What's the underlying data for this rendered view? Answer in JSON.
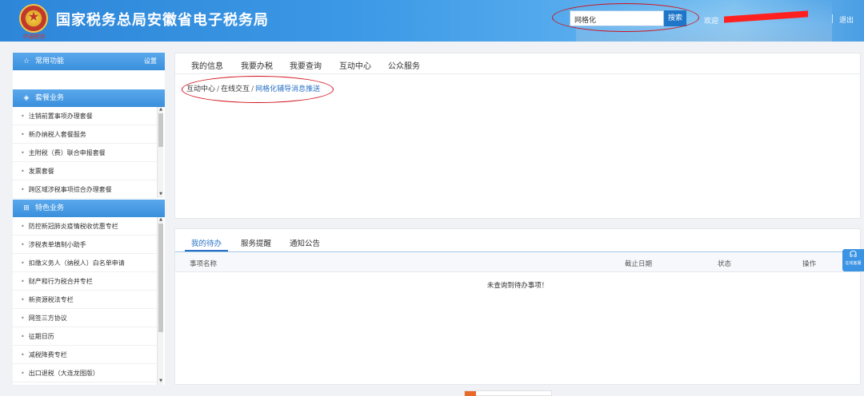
{
  "header": {
    "title": "国家税务总局安徽省电子税务局",
    "emblem_caption": "中国税务",
    "search_value": "网格化",
    "search_button": "搜索",
    "welcome_prefix": "欢迎",
    "logout": "退出"
  },
  "sidebar": {
    "common": {
      "title": "常用功能",
      "settings": "设置",
      "icon": "star-outline-icon"
    },
    "package": {
      "title": "套餐业务",
      "icon": "layers-icon",
      "items": [
        "注销前置事项办理套餐",
        "新办纳税人套餐服务",
        "主附税（费）联合申报套餐",
        "发票套餐",
        "跨区域涉税事项综合办理套餐"
      ]
    },
    "feature": {
      "title": "特色业务",
      "icon": "grid-icon",
      "items": [
        "防控新冠肺炎疫情税收优惠专栏",
        "涉税表单填制小助手",
        "扣缴义务人（纳税人）白名单申请",
        "财产和行为税合并专栏",
        "新资源税法专栏",
        "网签三方协议",
        "征期日历",
        "减税降费专栏",
        "出口退税（大连龙图版）"
      ]
    }
  },
  "nav": {
    "items": [
      "我的信息",
      "我要办税",
      "我要查询",
      "互动中心",
      "公众服务"
    ]
  },
  "breadcrumb": {
    "items": [
      "互动中心",
      "在线交互",
      "网格化辅导消息推送"
    ],
    "separator": "/"
  },
  "todo": {
    "tabs": [
      "我的待办",
      "服务提醒",
      "通知公告"
    ],
    "columns": [
      "事项名称",
      "截止日期",
      "状态",
      "操作"
    ],
    "empty_message": "未查询到待办事项！"
  },
  "float_service": {
    "label": "在线客服",
    "icon": "headset-icon"
  },
  "colors": {
    "header_blue": "#3b98e6",
    "accent_blue": "#2a72c6",
    "annotation_red": "#d0101a"
  }
}
